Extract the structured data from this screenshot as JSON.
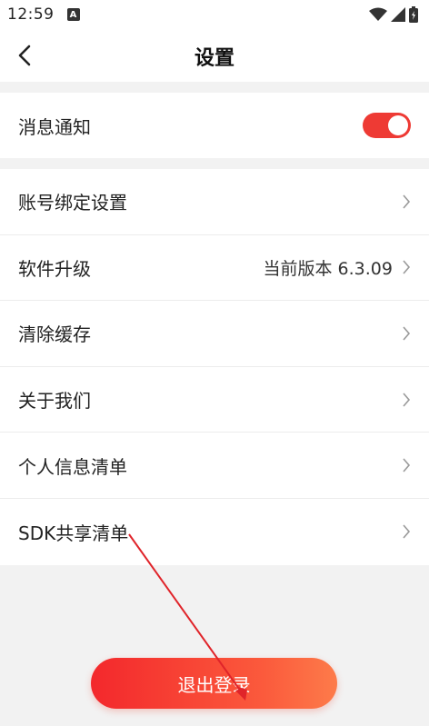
{
  "status_bar": {
    "time": "12:59",
    "notification_letter": "A"
  },
  "header": {
    "title": "设置"
  },
  "notify": {
    "label": "消息通知",
    "enabled": true
  },
  "menu": [
    {
      "label": "账号绑定设置",
      "value": ""
    },
    {
      "label": "软件升级",
      "value": "当前版本 6.3.09"
    },
    {
      "label": "清除缓存",
      "value": ""
    },
    {
      "label": "关于我们",
      "value": ""
    },
    {
      "label": "个人信息清单",
      "value": ""
    },
    {
      "label": "SDK共享清单",
      "value": ""
    }
  ],
  "logout": {
    "label": "退出登录"
  },
  "colors": {
    "accent": "#ee3a34",
    "annotation_arrow": "#e0242a"
  }
}
